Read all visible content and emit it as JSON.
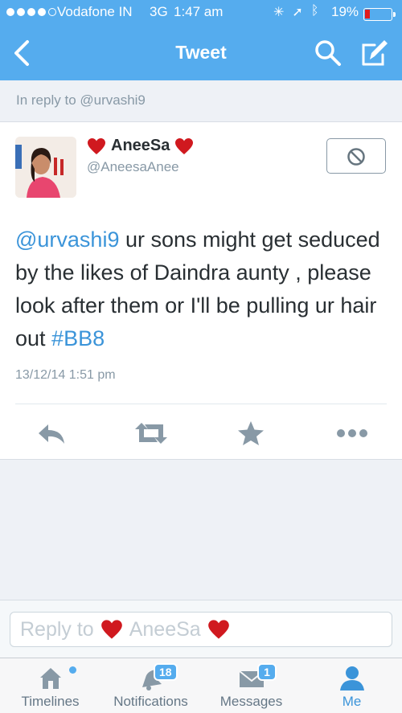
{
  "status_bar": {
    "carrier": "Vodafone IN",
    "network": "3G",
    "time": "1:47 am",
    "battery_percent": "19%",
    "battery_level": 0.19,
    "signal_bars": 4
  },
  "nav": {
    "back_icon": "chevron-left-icon",
    "title": "Tweet",
    "search_icon": "search-icon",
    "compose_icon": "compose-icon"
  },
  "reply_context": "In reply to @urvashi9",
  "tweet": {
    "author_name": "AneeSa",
    "author_handle": "@AneesaAnee",
    "text_mention": "@urvashi9",
    "text_body": " ur sons might get seduced by the likes of Daindra aunty , please look after them or I'll be pulling ur hair out ",
    "text_hashtag": "#BB8",
    "timestamp": "13/12/14 1:51 pm",
    "actions": [
      "reply-icon",
      "retweet-icon",
      "favorite-icon",
      "more-icon"
    ]
  },
  "reply_bar": {
    "placeholder_prefix": "Reply to",
    "placeholder_name": "AneeSa"
  },
  "tabs": [
    {
      "label": "Timelines",
      "icon": "home-icon",
      "badge": ""
    },
    {
      "label": "Notifications",
      "icon": "notifications-icon",
      "badge": "18"
    },
    {
      "label": "Messages",
      "icon": "messages-icon",
      "badge": "1"
    },
    {
      "label": "Me",
      "icon": "profile-icon",
      "badge": ""
    }
  ],
  "colors": {
    "brand": "#55acee",
    "link": "#3b94d9",
    "heart": "#d0191f"
  }
}
